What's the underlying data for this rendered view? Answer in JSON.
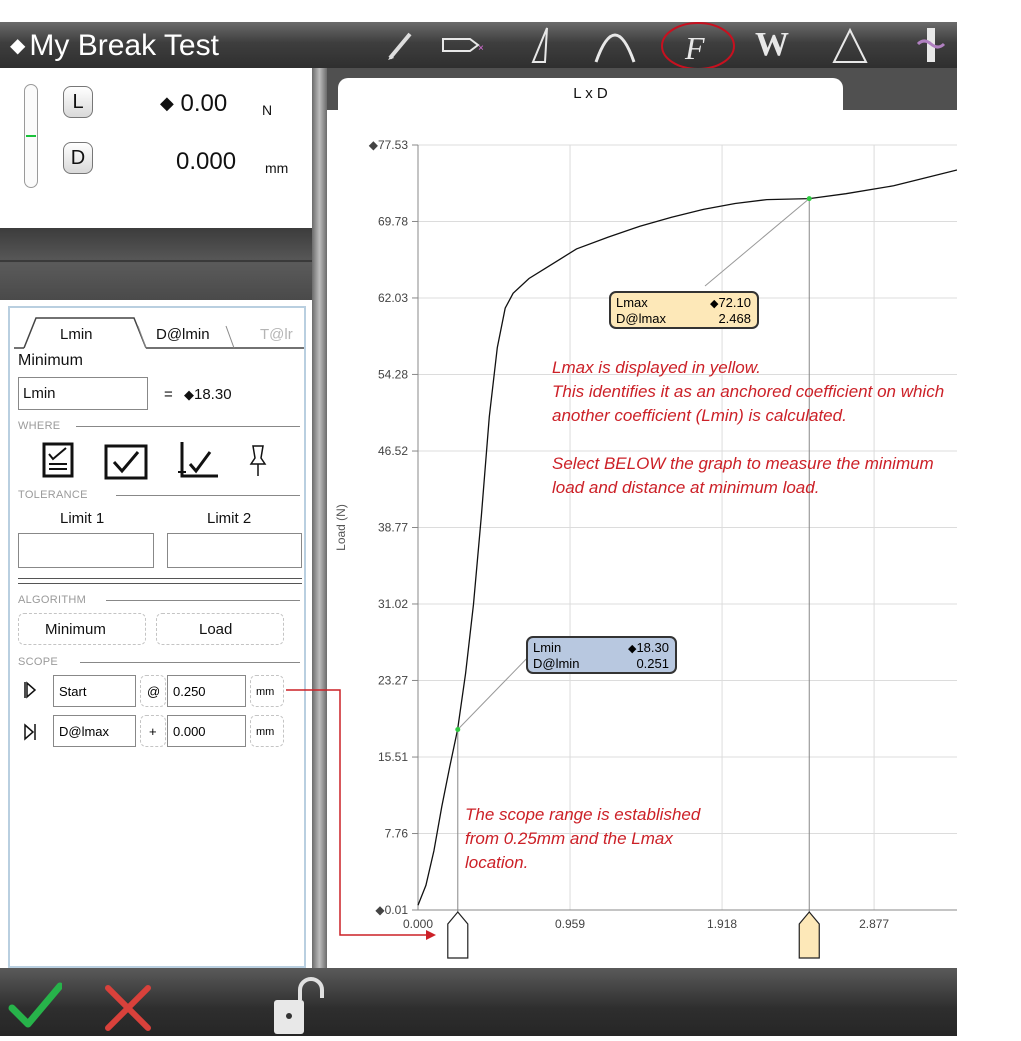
{
  "app": {
    "title": "My Break Test"
  },
  "toolbar": {
    "tools": [
      "pencil-tool",
      "marker-tool",
      "slope-tool",
      "peak-tool",
      "coefficient-tool",
      "work-tool",
      "delta-tool",
      "break-tool"
    ],
    "highlighted": "coefficient-tool"
  },
  "readout": {
    "load": {
      "key": "L",
      "value": "0.00",
      "unit": "N"
    },
    "distance": {
      "key": "D",
      "value": "0.000",
      "unit": "mm"
    }
  },
  "coef_panel": {
    "tabs": [
      "Lmin",
      "D@lmin",
      "T@lr"
    ],
    "heading": "Minimum",
    "name_value": "Lmin",
    "equals": "=",
    "result": "18.30",
    "where_label": "WHERE",
    "tolerance_label": "TOLERANCE",
    "limit1_label": "Limit 1",
    "limit2_label": "Limit 2",
    "algorithm_label": "ALGORITHM",
    "algorithm_value": "Minimum",
    "algorithm_channel": "Load",
    "scope_label": "SCOPE",
    "scope": [
      {
        "ref": "Start",
        "op": "@",
        "value": "0.250",
        "unit": "mm"
      },
      {
        "ref": "D@lmax",
        "op": "+",
        "value": "0.000",
        "unit": "mm"
      }
    ]
  },
  "chart_tab": "L x D",
  "chart_data": {
    "type": "line",
    "ylabel": "Load (N)",
    "xlabel": "",
    "y_ticks": [
      "77.53",
      "69.78",
      "62.03",
      "54.28",
      "46.52",
      "38.77",
      "31.02",
      "23.27",
      "15.51",
      "7.76",
      "0.01"
    ],
    "x_ticks": [
      "0.000",
      "0.959",
      "1.918",
      "2.877"
    ],
    "ylim": [
      0.01,
      77.53
    ],
    "xlim": [
      0.0,
      3.4
    ],
    "series": [
      {
        "x": [
          0.0,
          0.05,
          0.1,
          0.15,
          0.2,
          0.25,
          0.3,
          0.35,
          0.4,
          0.45,
          0.5,
          0.55,
          0.6,
          0.7,
          0.8,
          0.9,
          1.0,
          1.2,
          1.4,
          1.6,
          1.8,
          2.0,
          2.2,
          2.468,
          2.7,
          3.0,
          3.2,
          3.4
        ],
        "y": [
          0.5,
          2.5,
          6,
          10.5,
          14.5,
          18.3,
          24,
          31,
          40,
          50,
          57,
          61,
          62.5,
          64,
          65,
          66,
          67,
          68.2,
          69.3,
          70.2,
          71,
          71.6,
          72.0,
          72.1,
          72.6,
          73.4,
          74.2,
          75.0
        ]
      }
    ],
    "markers": [
      {
        "name": "Lmin",
        "x": 0.251,
        "y": 18.3
      },
      {
        "name": "Lmax",
        "x": 2.468,
        "y": 72.1
      }
    ]
  },
  "callouts": {
    "lmax": {
      "row1_label": "Lmax",
      "row1_value": "72.10",
      "row2_label": "D@lmax",
      "row2_value": "2.468",
      "color": "#fde8b8"
    },
    "lmin": {
      "row1_label": "Lmin",
      "row1_value": "18.30",
      "row2_label": "D@lmin",
      "row2_value": "0.251",
      "color": "#b8c8e0"
    }
  },
  "annotations": {
    "note1": "Lmax is displayed in yellow.",
    "note2": "This identifies it as an anchored coefficient on which",
    "note3": "another coefficient (Lmin) is calculated.",
    "note4": "Select BELOW the graph to measure the minimum",
    "note5": "load and distance at minimum load.",
    "scope1": "The scope range is established",
    "scope2": "from 0.25mm and the Lmax",
    "scope3": "location."
  },
  "colors": {
    "annotation": "#cc2027",
    "grid": "#d8d8d8",
    "accent_green": "#27b34a",
    "cancel_red": "#d9413b"
  }
}
